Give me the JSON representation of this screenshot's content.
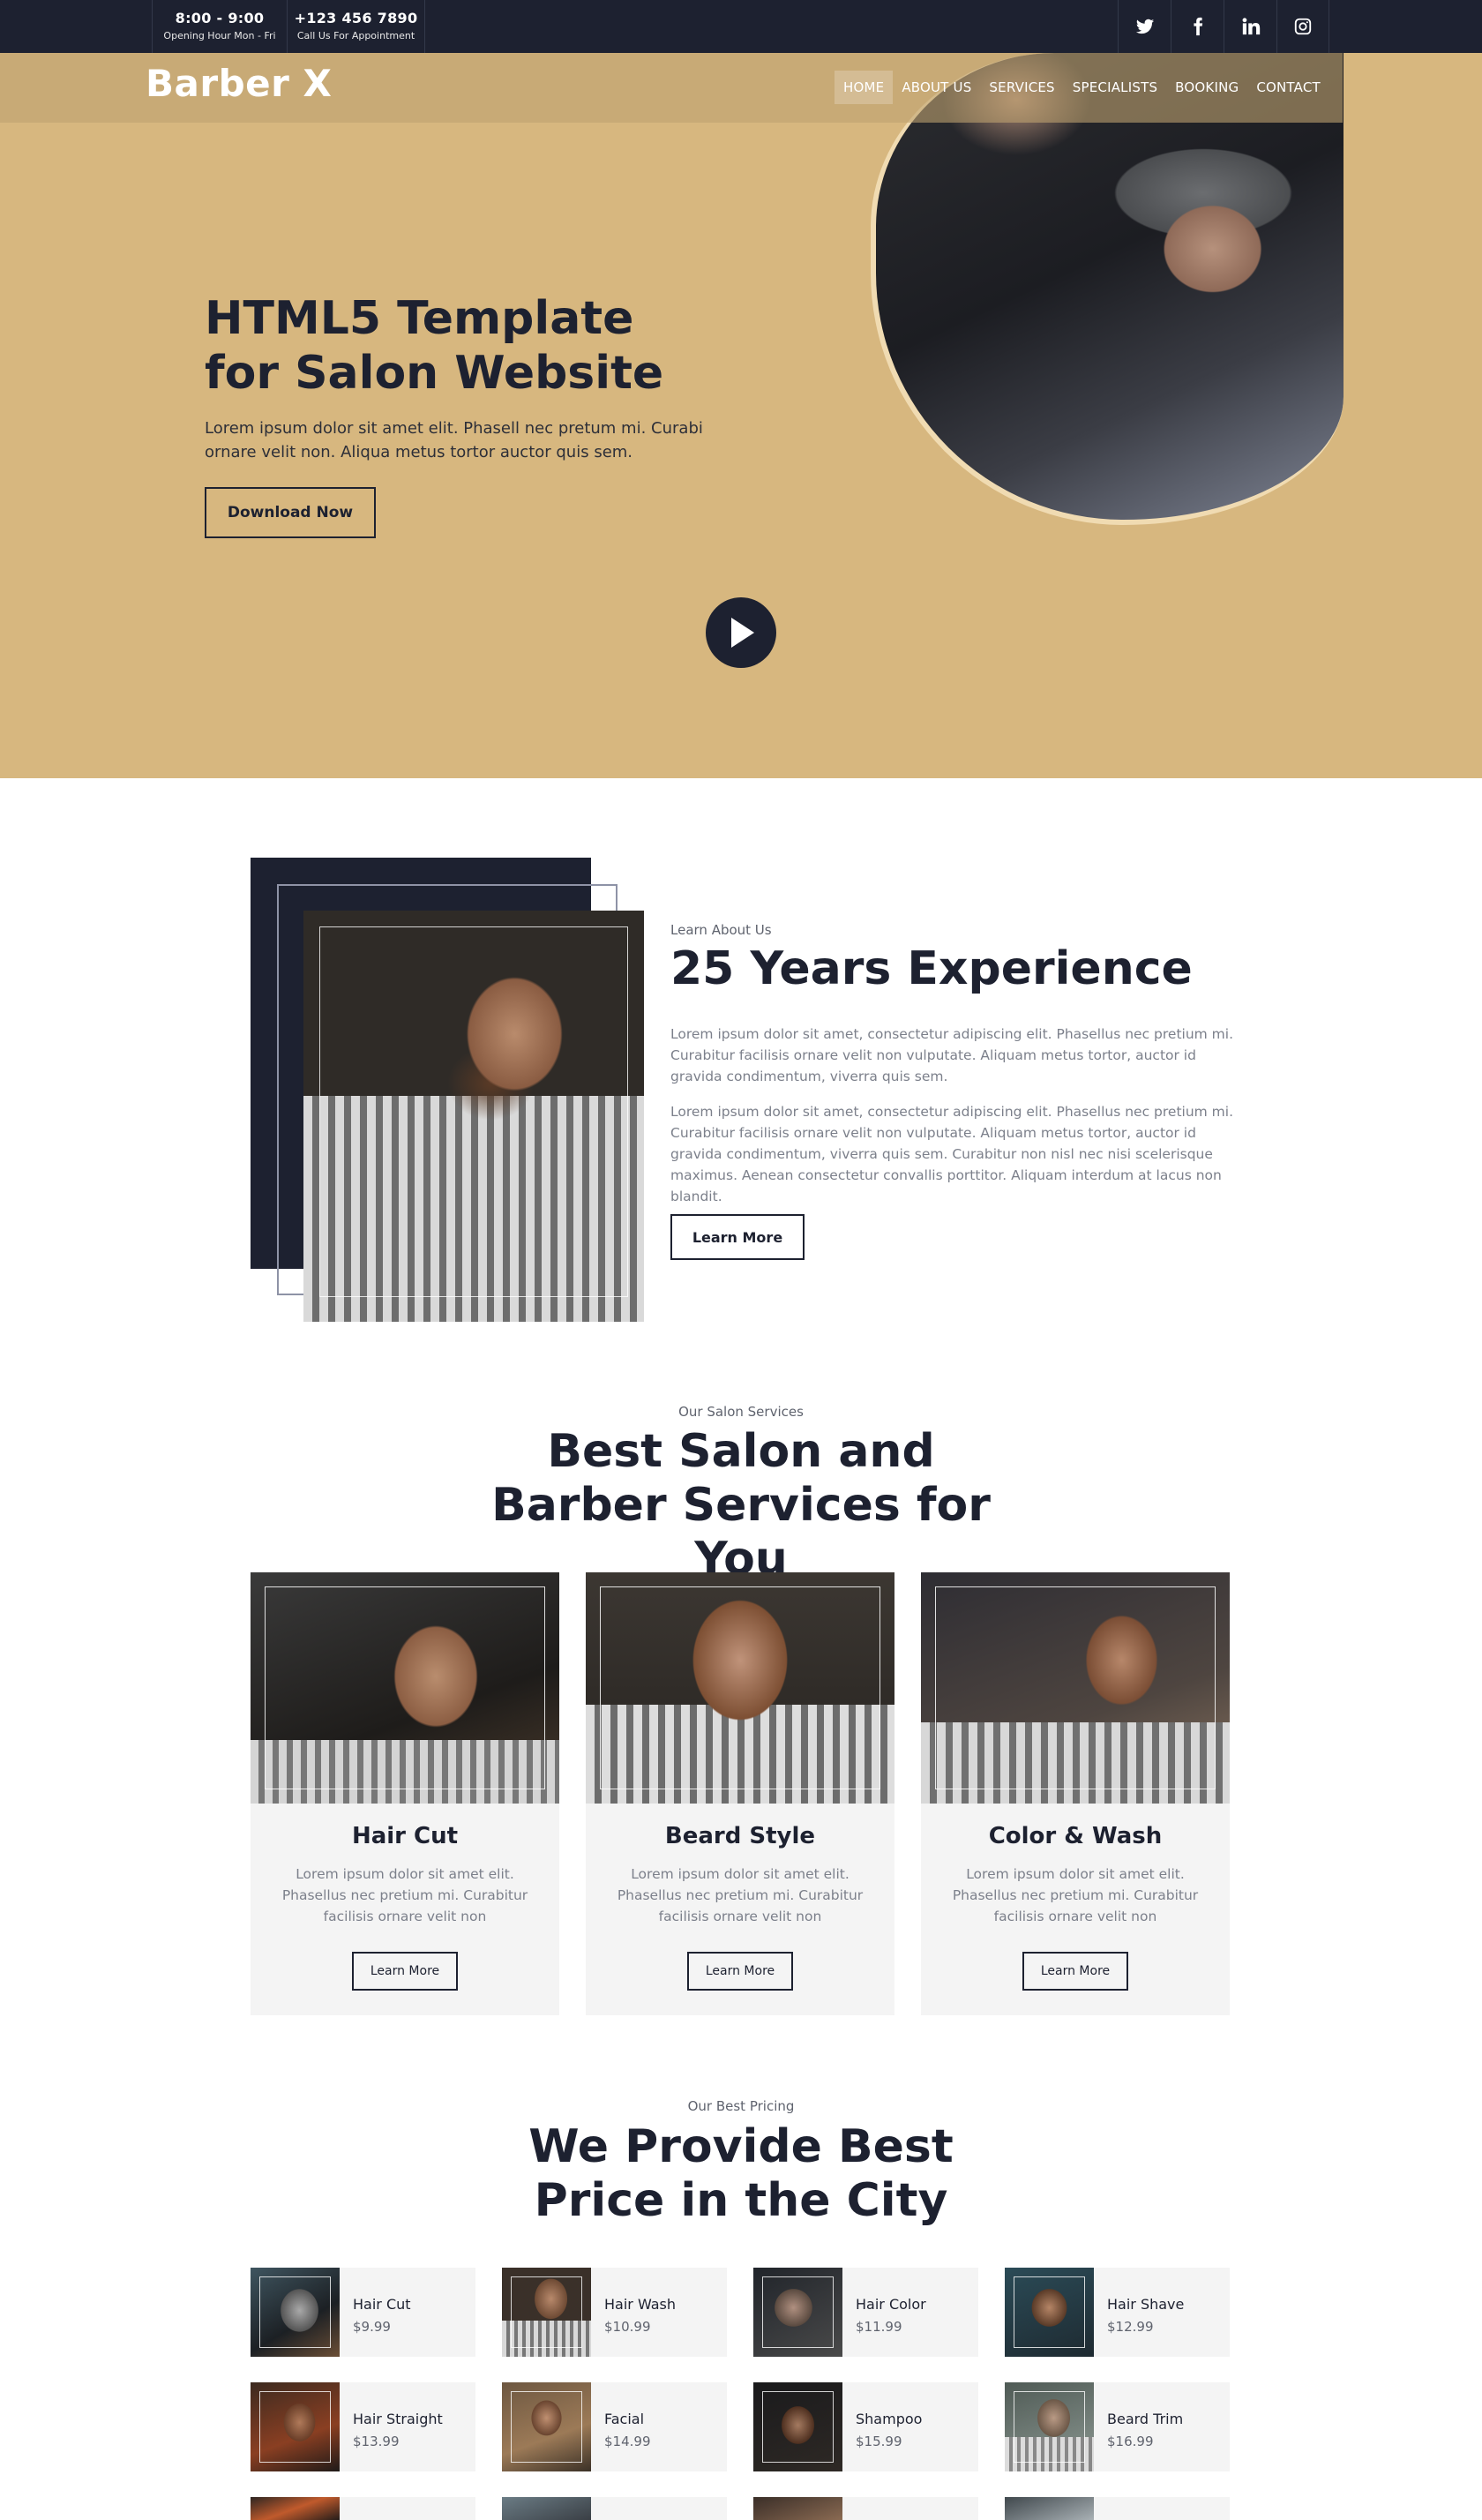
{
  "topbar": {
    "hours": "8:00 - 9:00",
    "hours_label": "Opening Hour Mon - Fri",
    "phone": "+123 456 7890",
    "phone_label": "Call Us For Appointment",
    "social": [
      "twitter-icon",
      "facebook-icon",
      "linkedin-icon",
      "instagram-icon"
    ]
  },
  "brand": {
    "logo": "Barber X"
  },
  "nav": {
    "items": [
      "HOME",
      "ABOUT US",
      "SERVICES",
      "SPECIALISTS",
      "BOOKING",
      "CONTACT"
    ],
    "active": "HOME"
  },
  "hero": {
    "title": "HTML5 Template for Salon Website",
    "text": "Lorem ipsum dolor sit amet elit. Phasell nec pretum mi. Curabi ornare velit non. Aliqua metus tortor auctor quis sem.",
    "button": "Download Now",
    "play_icon": "play-icon"
  },
  "about": {
    "label": "Learn About Us",
    "title": "25 Years Experience",
    "p1": "Lorem ipsum dolor sit amet, consectetur adipiscing elit. Phasellus nec pretium mi. Curabitur facilisis ornare velit non vulputate. Aliquam metus tortor, auctor id gravida condimentum, viverra quis sem.",
    "p2": "Lorem ipsum dolor sit amet, consectetur adipiscing elit. Phasellus nec pretium mi. Curabitur facilisis ornare velit non vulputate. Aliquam metus tortor, auctor id gravida condimentum, viverra quis sem. Curabitur non nisl nec nisi scelerisque maximus. Aenean consectetur convallis porttitor. Aliquam interdum at lacus non blandit.",
    "button": "Learn More"
  },
  "services": {
    "label": "Our Salon Services",
    "title": "Best Salon and Barber Services for You",
    "cards": [
      {
        "title": "Hair Cut",
        "text": "Lorem ipsum dolor sit amet elit. Phasellus nec pretium mi. Curabitur facilisis ornare velit non",
        "button": "Learn More"
      },
      {
        "title": "Beard Style",
        "text": "Lorem ipsum dolor sit amet elit. Phasellus nec pretium mi. Curabitur facilisis ornare velit non",
        "button": "Learn More"
      },
      {
        "title": "Color & Wash",
        "text": "Lorem ipsum dolor sit amet elit. Phasellus nec pretium mi. Curabitur facilisis ornare velit non",
        "button": "Learn More"
      }
    ]
  },
  "pricing": {
    "label": "Our Best Pricing",
    "title": "We Provide Best Price in the City",
    "items": [
      {
        "name": "Hair Cut",
        "price": "$9.99"
      },
      {
        "name": "Hair Wash",
        "price": "$10.99"
      },
      {
        "name": "Hair Color",
        "price": "$11.99"
      },
      {
        "name": "Hair Shave",
        "price": "$12.99"
      },
      {
        "name": "Hair Straight",
        "price": "$13.99"
      },
      {
        "name": "Facial",
        "price": "$14.99"
      },
      {
        "name": "Shampoo",
        "price": "$15.99"
      },
      {
        "name": "Beard Trim",
        "price": "$16.99"
      }
    ]
  },
  "colors": {
    "dark": "#1d2130",
    "gold": "#d7b77f",
    "light_panel": "#f4f4f4",
    "muted_text": "#7c808b"
  }
}
